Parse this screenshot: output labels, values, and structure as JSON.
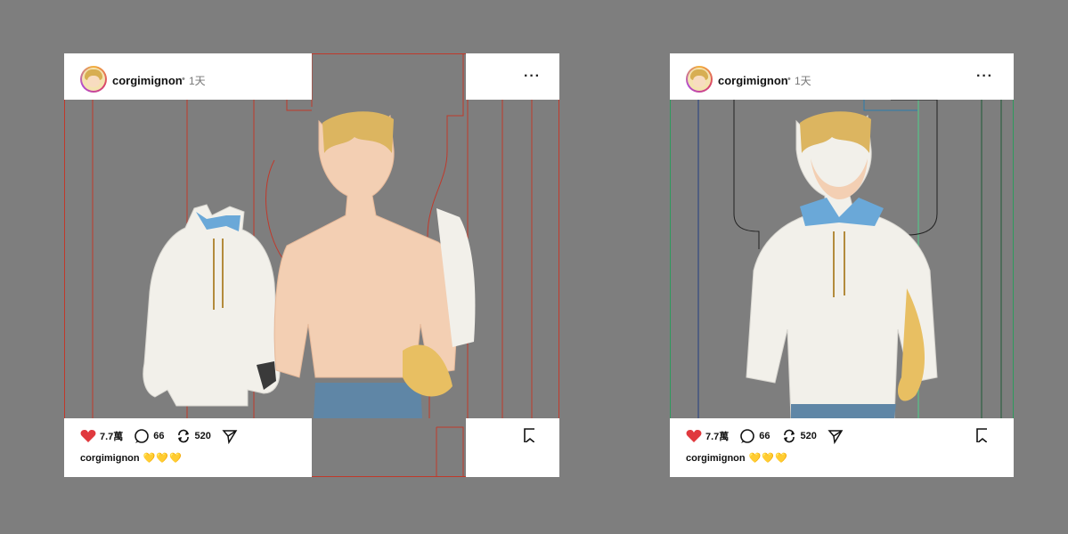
{
  "post": {
    "username": "corgimignon",
    "dot": "•",
    "time": "1天",
    "more": "···",
    "likes": "7.7萬",
    "comments": "66",
    "reposts": "520",
    "caption_user": "corgimignon",
    "caption_emoji": "💛💛💛"
  },
  "colors": {
    "background": "#7e7e7e",
    "left_outline": "#c0392b",
    "right_outline": "#2e9a5e",
    "heart": "#e0393e",
    "hoodie": "#f2f0ea",
    "hair": "#dcb560",
    "skin": "#f3cfb3",
    "jeans": "#5f86a6"
  }
}
